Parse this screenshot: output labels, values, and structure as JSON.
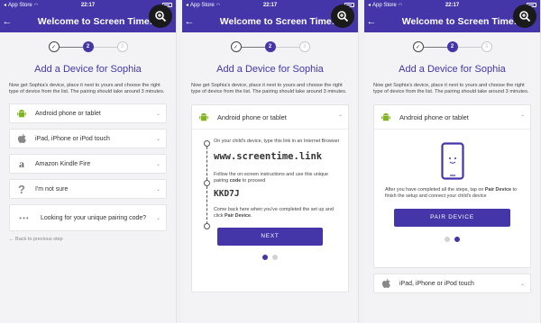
{
  "status": {
    "carrier": "App Store",
    "time": "22:17"
  },
  "app": {
    "title": "Welcome to Screen Time!"
  },
  "stepper": {
    "step1": "✓",
    "step2": "2",
    "step3": "3"
  },
  "heading": "Add a Device for Sophia",
  "intro": "Now get Sophia's device, place it next to yours and choose the right type of device from the list. The pairing should take around 3 minutes.",
  "options": [
    {
      "label": "Android phone or tablet",
      "icon": "android-icon"
    },
    {
      "label": "iPad, iPhone or iPod touch",
      "icon": "apple-icon"
    },
    {
      "label": "Amazon Kindle Fire",
      "icon": "amazon-icon"
    },
    {
      "label": "I'm not sure",
      "icon": "question-icon"
    },
    {
      "label": "Looking for your unique pairing code?",
      "icon": "dots-icon"
    }
  ],
  "back_link": "Back to previous step",
  "android_steps": {
    "step1": "On your child's device, type this link in an Internet Browser",
    "link": "www.screentime.link",
    "step2_pre": "Follow the on-screen instructions and use this unique pairing ",
    "step2_bold": "code",
    "step2_post": " to proceed",
    "code": "KKD7J",
    "step3_pre": "Come back here when you've completed the set up and click ",
    "step3_bold": "Pair Device",
    "step3_post": ".",
    "next_label": "NEXT"
  },
  "pair": {
    "pre": "After you have completed all the steps, tap on ",
    "bold": "Pair Device",
    "post": " to finish the setup and connect your child's device",
    "button": "PAIR DEVICE"
  },
  "colors": {
    "primary": "#4436a8",
    "android": "#7fb51e"
  }
}
